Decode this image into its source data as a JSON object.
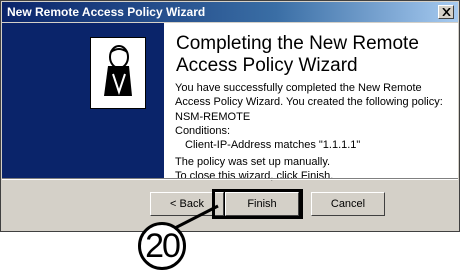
{
  "window": {
    "title": "New Remote Access Policy Wizard"
  },
  "content": {
    "heading": "Completing the New Remote Access Policy Wizard",
    "intro": "You have successfully completed the New Remote Access Policy Wizard. You created the following policy:",
    "policy_name": "NSM-REMOTE",
    "conditions_label": "Conditions:",
    "condition": "Client-IP-Address matches \"1.1.1.1\"",
    "manual_note": "The policy was set up manually.",
    "close_note": "To close this wizard, click Finish."
  },
  "buttons": {
    "back": "< Back",
    "finish": "Finish",
    "cancel": "Cancel"
  },
  "callout": {
    "number": "20"
  },
  "colors": {
    "titlebar": "#0a246a",
    "side_panel": "#0a246a",
    "dialog": "#d4d0c8"
  },
  "icons": {
    "close": "close-icon",
    "wizard": "policy-figure-icon"
  }
}
